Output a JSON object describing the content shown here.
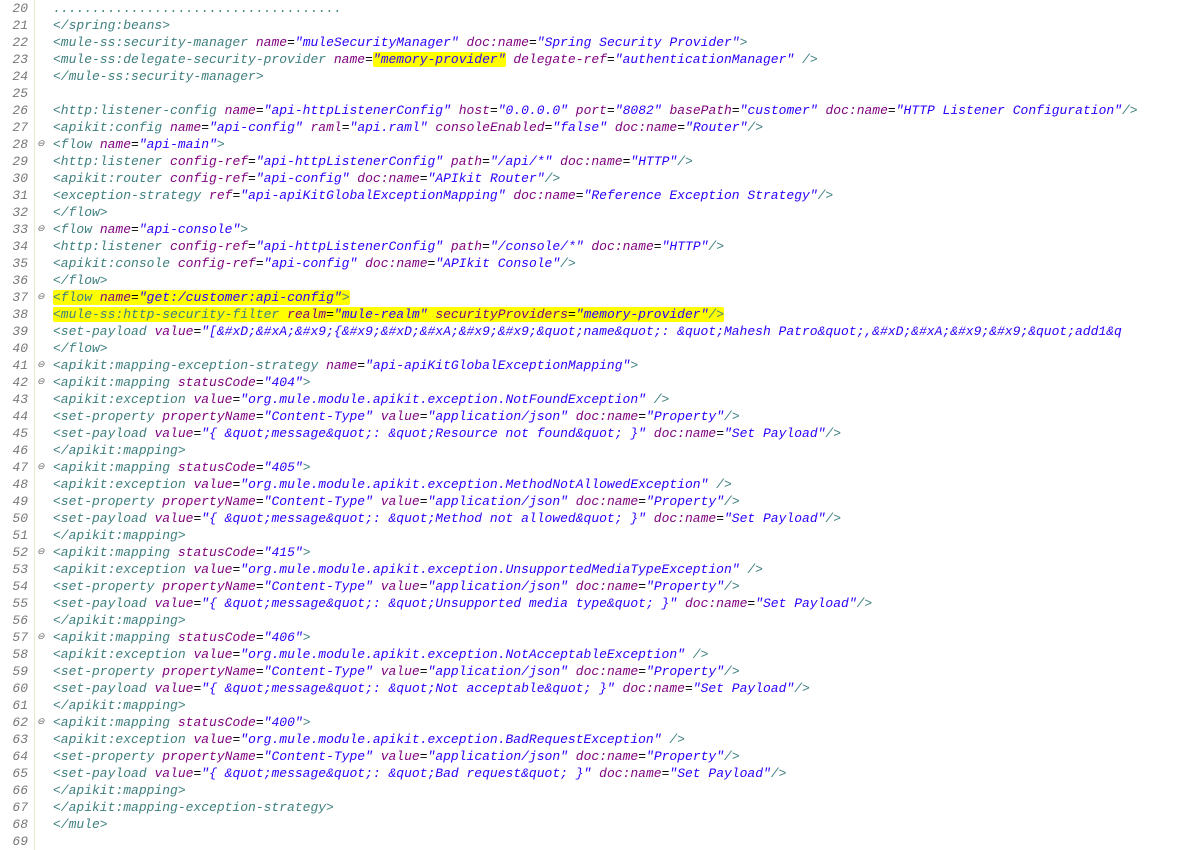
{
  "lines": [
    {
      "n": 20,
      "fold": "",
      "html": "            <span class='tag'>.....................................</span>"
    },
    {
      "n": 21,
      "fold": "",
      "html": "    <span class='tag'>&lt;/spring:beans&gt;</span>"
    },
    {
      "n": 22,
      "fold": "",
      "html": "    <span class='tag'>&lt;mule-ss:security-manager</span> <span class='attr'>name</span>=<span class='str'>&quot;muleSecurityManager&quot;</span> <span class='attr'>doc:name</span>=<span class='str'>&quot;Spring Security Provider&quot;</span><span class='tag'>&gt;</span>"
    },
    {
      "n": 23,
      "fold": "",
      "html": "        <span class='tag'>&lt;mule-ss:delegate-security-provider</span> <span class='attr'>name</span>=<span class='hl'><span class='str'>&quot;memory-provider&quot;</span></span> <span class='attr'>delegate-ref</span>=<span class='str'>&quot;authenticationManager&quot;</span> <span class='tag'>/&gt;</span>"
    },
    {
      "n": 24,
      "fold": "",
      "html": "    <span class='tag'>&lt;/mule-ss:security-manager&gt;</span>"
    },
    {
      "n": 25,
      "fold": "",
      "html": ""
    },
    {
      "n": 26,
      "fold": "",
      "html": "        <span class='tag'>&lt;http:listener-config</span> <span class='attr'>name</span>=<span class='str'>&quot;api-httpListenerConfig&quot;</span> <span class='attr'>host</span>=<span class='str'>&quot;0.0.0.0&quot;</span> <span class='attr'>port</span>=<span class='str'>&quot;8082&quot;</span> <span class='attr'>basePath</span>=<span class='str'>&quot;customer&quot;</span> <span class='attr'>doc:name</span>=<span class='str'>&quot;HTTP Listener Configuration&quot;</span><span class='tag'>/&gt;</span>"
    },
    {
      "n": 27,
      "fold": "",
      "html": "        <span class='tag'>&lt;apikit:config</span> <span class='attr'>name</span>=<span class='str'>&quot;api-config&quot;</span> <span class='attr'>raml</span>=<span class='str'>&quot;api.raml&quot;</span> <span class='attr'>consoleEnabled</span>=<span class='str'>&quot;false&quot;</span> <span class='attr'>doc:name</span>=<span class='str'>&quot;Router&quot;</span><span class='tag'>/&gt;</span>"
    },
    {
      "n": 28,
      "fold": "⊖",
      "html": "        <span class='tag'>&lt;flow</span> <span class='attr'>name</span>=<span class='str'>&quot;api-main&quot;</span><span class='tag'>&gt;</span>"
    },
    {
      "n": 29,
      "fold": "",
      "html": "            <span class='tag'>&lt;http:listener</span> <span class='attr'>config-ref</span>=<span class='str'>&quot;api-httpListenerConfig&quot;</span> <span class='attr'>path</span>=<span class='str'>&quot;/api/*&quot;</span> <span class='attr'>doc:name</span>=<span class='str'>&quot;HTTP&quot;</span><span class='tag'>/&gt;</span>"
    },
    {
      "n": 30,
      "fold": "",
      "html": "            <span class='tag'>&lt;apikit:router</span> <span class='attr'>config-ref</span>=<span class='str'>&quot;api-config&quot;</span> <span class='attr'>doc:name</span>=<span class='str'>&quot;APIkit Router&quot;</span><span class='tag'>/&gt;</span>"
    },
    {
      "n": 31,
      "fold": "",
      "html": "            <span class='tag'>&lt;exception-strategy</span> <span class='attr'>ref</span>=<span class='str'>&quot;api-apiKitGlobalExceptionMapping&quot;</span> <span class='attr'>doc:name</span>=<span class='str'>&quot;Reference Exception Strategy&quot;</span><span class='tag'>/&gt;</span>"
    },
    {
      "n": 32,
      "fold": "",
      "html": "        <span class='tag'>&lt;/flow&gt;</span>"
    },
    {
      "n": 33,
      "fold": "⊖",
      "html": "        <span class='tag'>&lt;flow</span> <span class='attr'>name</span>=<span class='str'>&quot;api-console&quot;</span><span class='tag'>&gt;</span>"
    },
    {
      "n": 34,
      "fold": "",
      "html": "            <span class='tag'>&lt;http:listener</span> <span class='attr'>config-ref</span>=<span class='str'>&quot;api-httpListenerConfig&quot;</span> <span class='attr'>path</span>=<span class='str'>&quot;/console/*&quot;</span> <span class='attr'>doc:name</span>=<span class='str'>&quot;HTTP&quot;</span><span class='tag'>/&gt;</span>"
    },
    {
      "n": 35,
      "fold": "",
      "html": "            <span class='tag'>&lt;apikit:console</span> <span class='attr'>config-ref</span>=<span class='str'>&quot;api-config&quot;</span> <span class='attr'>doc:name</span>=<span class='str'>&quot;APIkit Console&quot;</span><span class='tag'>/&gt;</span>"
    },
    {
      "n": 36,
      "fold": "",
      "html": "        <span class='tag'>&lt;/flow&gt;</span>"
    },
    {
      "n": 37,
      "fold": "⊖",
      "html": "        <span class='hl'><span class='tag'>&lt;flow</span> <span class='attr'>name</span>=<span class='str'>&quot;get:/customer:api-config&quot;</span><span class='tag'>&gt;</span>                                                             </span>"
    },
    {
      "n": 38,
      "fold": "",
      "html": "            <span class='hl'><span class='tag'>&lt;mule-ss:http-security-filter</span> <span class='attr'>realm</span>=<span class='str'>&quot;mule-realm&quot;</span> <span class='attr'>securityProviders</span>=<span class='str'>&quot;memory-provider&quot;</span><span class='tag'>/&gt;</span></span>"
    },
    {
      "n": 39,
      "fold": "",
      "html": "            <span class='tag'>&lt;set-payload</span> <span class='attr'>value</span>=<span class='str'>&quot;[&amp;#xD;&amp;#xA;&amp;#x9;{&amp;#x9;&amp;#xD;&amp;#xA;&amp;#x9;&amp;#x9;&amp;quot;name&amp;quot;: &amp;quot;Mahesh Patro&amp;quot;,&amp;#xD;&amp;#xA;&amp;#x9;&amp;#x9;&amp;quot;add1&amp;q</span>"
    },
    {
      "n": 40,
      "fold": "",
      "html": "        <span class='tag'>&lt;/flow&gt;</span>"
    },
    {
      "n": 41,
      "fold": "⊖",
      "html": "        <span class='tag'>&lt;apikit:mapping-exception-strategy</span> <span class='attr'>name</span>=<span class='str'>&quot;api-apiKitGlobalExceptionMapping&quot;</span><span class='tag'>&gt;</span>"
    },
    {
      "n": 42,
      "fold": "⊖",
      "html": "            <span class='tag'>&lt;apikit:mapping</span> <span class='attr'>statusCode</span>=<span class='str'>&quot;404&quot;</span><span class='tag'>&gt;</span>"
    },
    {
      "n": 43,
      "fold": "",
      "html": "                <span class='tag'>&lt;apikit:exception</span> <span class='attr'>value</span>=<span class='str'>&quot;org.mule.module.apikit.exception.NotFoundException&quot;</span> <span class='tag'>/&gt;</span>"
    },
    {
      "n": 44,
      "fold": "",
      "html": "                <span class='tag'>&lt;set-property</span> <span class='attr'>propertyName</span>=<span class='str'>&quot;Content-Type&quot;</span> <span class='attr'>value</span>=<span class='str'>&quot;application/json&quot;</span> <span class='attr'>doc:name</span>=<span class='str'>&quot;Property&quot;</span><span class='tag'>/&gt;</span>"
    },
    {
      "n": 45,
      "fold": "",
      "html": "                <span class='tag'>&lt;set-payload</span> <span class='attr'>value</span>=<span class='str'>&quot;{ &amp;quot;message&amp;quot;: &amp;quot;Resource not found&amp;quot; }&quot;</span> <span class='attr'>doc:name</span>=<span class='str'>&quot;Set Payload&quot;</span><span class='tag'>/&gt;</span>"
    },
    {
      "n": 46,
      "fold": "",
      "html": "            <span class='tag'>&lt;/apikit:mapping&gt;</span>"
    },
    {
      "n": 47,
      "fold": "⊖",
      "html": "            <span class='tag'>&lt;apikit:mapping</span> <span class='attr'>statusCode</span>=<span class='str'>&quot;405&quot;</span><span class='tag'>&gt;</span>"
    },
    {
      "n": 48,
      "fold": "",
      "html": "                <span class='tag'>&lt;apikit:exception</span> <span class='attr'>value</span>=<span class='str'>&quot;org.mule.module.apikit.exception.MethodNotAllowedException&quot;</span> <span class='tag'>/&gt;</span>"
    },
    {
      "n": 49,
      "fold": "",
      "html": "                <span class='tag'>&lt;set-property</span> <span class='attr'>propertyName</span>=<span class='str'>&quot;Content-Type&quot;</span> <span class='attr'>value</span>=<span class='str'>&quot;application/json&quot;</span> <span class='attr'>doc:name</span>=<span class='str'>&quot;Property&quot;</span><span class='tag'>/&gt;</span>"
    },
    {
      "n": 50,
      "fold": "",
      "html": "                <span class='tag'>&lt;set-payload</span> <span class='attr'>value</span>=<span class='str'>&quot;{ &amp;quot;message&amp;quot;: &amp;quot;Method not allowed&amp;quot; }&quot;</span> <span class='attr'>doc:name</span>=<span class='str'>&quot;Set Payload&quot;</span><span class='tag'>/&gt;</span>"
    },
    {
      "n": 51,
      "fold": "",
      "html": "            <span class='tag'>&lt;/apikit:mapping&gt;</span>"
    },
    {
      "n": 52,
      "fold": "⊖",
      "html": "            <span class='tag'>&lt;apikit:mapping</span> <span class='attr'>statusCode</span>=<span class='str'>&quot;415&quot;</span><span class='tag'>&gt;</span>"
    },
    {
      "n": 53,
      "fold": "",
      "html": "                <span class='tag'>&lt;apikit:exception</span> <span class='attr'>value</span>=<span class='str'>&quot;org.mule.module.apikit.exception.UnsupportedMediaTypeException&quot;</span> <span class='tag'>/&gt;</span>"
    },
    {
      "n": 54,
      "fold": "",
      "html": "                <span class='tag'>&lt;set-property</span> <span class='attr'>propertyName</span>=<span class='str'>&quot;Content-Type&quot;</span> <span class='attr'>value</span>=<span class='str'>&quot;application/json&quot;</span> <span class='attr'>doc:name</span>=<span class='str'>&quot;Property&quot;</span><span class='tag'>/&gt;</span>"
    },
    {
      "n": 55,
      "fold": "",
      "html": "                <span class='tag'>&lt;set-payload</span> <span class='attr'>value</span>=<span class='str'>&quot;{ &amp;quot;message&amp;quot;: &amp;quot;Unsupported media type&amp;quot; }&quot;</span> <span class='attr'>doc:name</span>=<span class='str'>&quot;Set Payload&quot;</span><span class='tag'>/&gt;</span>"
    },
    {
      "n": 56,
      "fold": "",
      "html": "            <span class='tag'>&lt;/apikit:mapping&gt;</span>"
    },
    {
      "n": 57,
      "fold": "⊖",
      "html": "            <span class='tag'>&lt;apikit:mapping</span> <span class='attr'>statusCode</span>=<span class='str'>&quot;406&quot;</span><span class='tag'>&gt;</span>"
    },
    {
      "n": 58,
      "fold": "",
      "html": "                <span class='tag'>&lt;apikit:exception</span> <span class='attr'>value</span>=<span class='str'>&quot;org.mule.module.apikit.exception.NotAcceptableException&quot;</span> <span class='tag'>/&gt;</span>"
    },
    {
      "n": 59,
      "fold": "",
      "html": "                <span class='tag'>&lt;set-property</span> <span class='attr'>propertyName</span>=<span class='str'>&quot;Content-Type&quot;</span> <span class='attr'>value</span>=<span class='str'>&quot;application/json&quot;</span> <span class='attr'>doc:name</span>=<span class='str'>&quot;Property&quot;</span><span class='tag'>/&gt;</span>"
    },
    {
      "n": 60,
      "fold": "",
      "html": "                <span class='tag'>&lt;set-payload</span> <span class='attr'>value</span>=<span class='str'>&quot;{ &amp;quot;message&amp;quot;: &amp;quot;Not acceptable&amp;quot; }&quot;</span> <span class='attr'>doc:name</span>=<span class='str'>&quot;Set Payload&quot;</span><span class='tag'>/&gt;</span>"
    },
    {
      "n": 61,
      "fold": "",
      "html": "            <span class='tag'>&lt;/apikit:mapping&gt;</span>"
    },
    {
      "n": 62,
      "fold": "⊖",
      "html": "            <span class='tag'>&lt;apikit:mapping</span> <span class='attr'>statusCode</span>=<span class='str'>&quot;400&quot;</span><span class='tag'>&gt;</span>"
    },
    {
      "n": 63,
      "fold": "",
      "html": "                <span class='tag'>&lt;apikit:exception</span> <span class='attr'>value</span>=<span class='str'>&quot;org.mule.module.apikit.exception.BadRequestException&quot;</span> <span class='tag'>/&gt;</span>"
    },
    {
      "n": 64,
      "fold": "",
      "html": "                <span class='tag'>&lt;set-property</span> <span class='attr'>propertyName</span>=<span class='str'>&quot;Content-Type&quot;</span> <span class='attr'>value</span>=<span class='str'>&quot;application/json&quot;</span> <span class='attr'>doc:name</span>=<span class='str'>&quot;Property&quot;</span><span class='tag'>/&gt;</span>"
    },
    {
      "n": 65,
      "fold": "",
      "html": "                <span class='tag'>&lt;set-payload</span> <span class='attr'>value</span>=<span class='str'>&quot;{ &amp;quot;message&amp;quot;: &amp;quot;Bad request&amp;quot; }&quot;</span> <span class='attr'>doc:name</span>=<span class='str'>&quot;Set Payload&quot;</span><span class='tag'>/&gt;</span>"
    },
    {
      "n": 66,
      "fold": "",
      "html": "            <span class='tag'>&lt;/apikit:mapping&gt;</span>"
    },
    {
      "n": 67,
      "fold": "",
      "html": "        <span class='tag'>&lt;/apikit:mapping-exception-strategy&gt;</span>"
    },
    {
      "n": 68,
      "fold": "",
      "html": "<span class='tag'>&lt;/mule&gt;</span>"
    },
    {
      "n": 69,
      "fold": "",
      "html": ""
    }
  ]
}
